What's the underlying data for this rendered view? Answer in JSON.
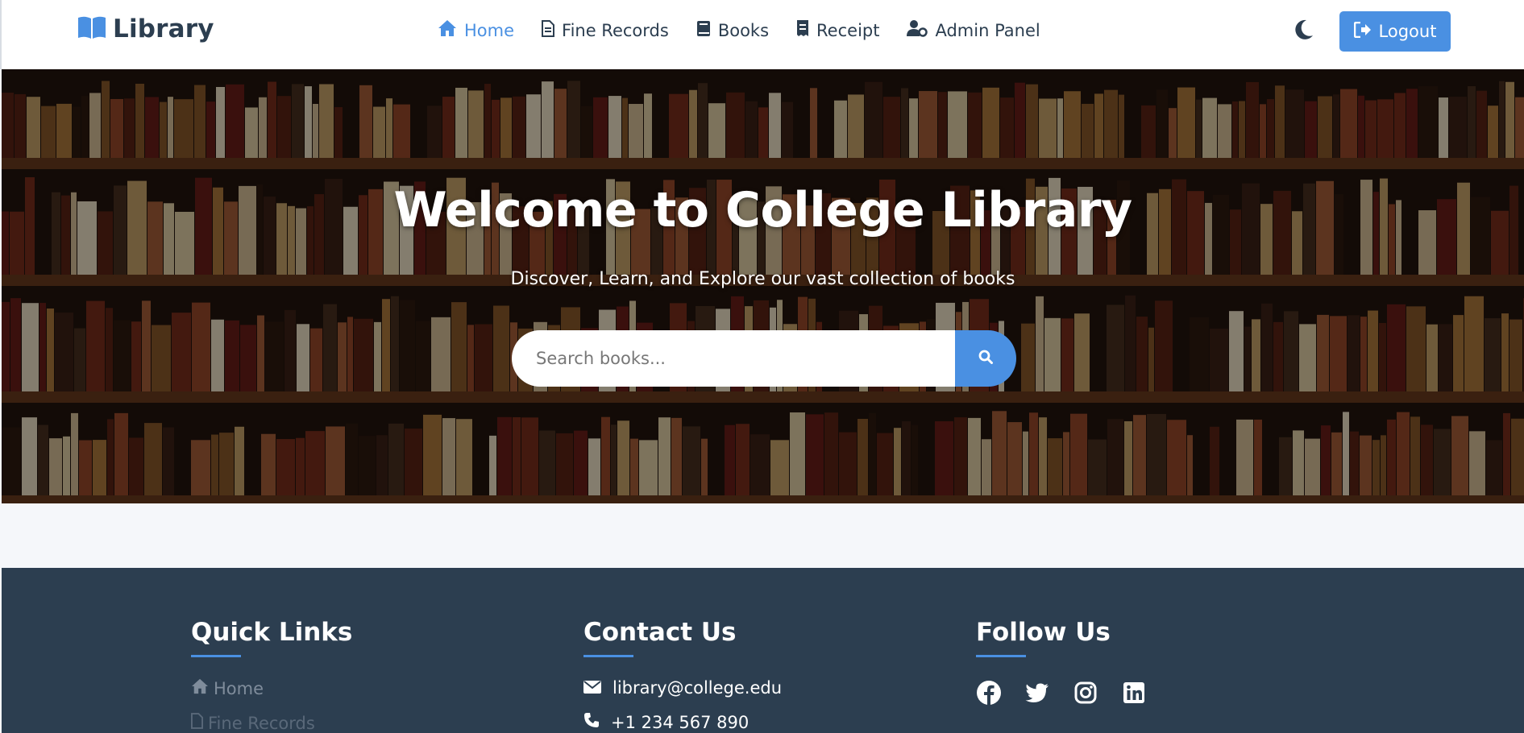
{
  "navbar": {
    "brand": "Library",
    "links": [
      {
        "label": "Home",
        "icon": "home-icon",
        "active": true
      },
      {
        "label": "Fine Records",
        "icon": "file-icon"
      },
      {
        "label": "Books",
        "icon": "book-icon"
      },
      {
        "label": "Receipt",
        "icon": "receipt-icon"
      },
      {
        "label": "Admin Panel",
        "icon": "user-cog-icon"
      }
    ],
    "theme_toggle_icon": "moon-icon",
    "logout_label": "Logout"
  },
  "hero": {
    "title": "Welcome to College Library",
    "subtitle": "Discover, Learn, and Explore our vast collection of books",
    "search_placeholder": "Search books..."
  },
  "footer": {
    "quick_links": {
      "title": "Quick Links",
      "items": [
        "Home",
        "Fine Records"
      ]
    },
    "contact": {
      "title": "Contact Us",
      "email": "library@college.edu",
      "phone": "+1 234 567 890"
    },
    "follow": {
      "title": "Follow Us",
      "icons": [
        "facebook-icon",
        "twitter-icon",
        "instagram-icon",
        "linkedin-icon"
      ]
    }
  },
  "colors": {
    "accent": "#4a90e2",
    "footer_bg": "#2c3e50",
    "text_dark": "#2c3e50"
  }
}
